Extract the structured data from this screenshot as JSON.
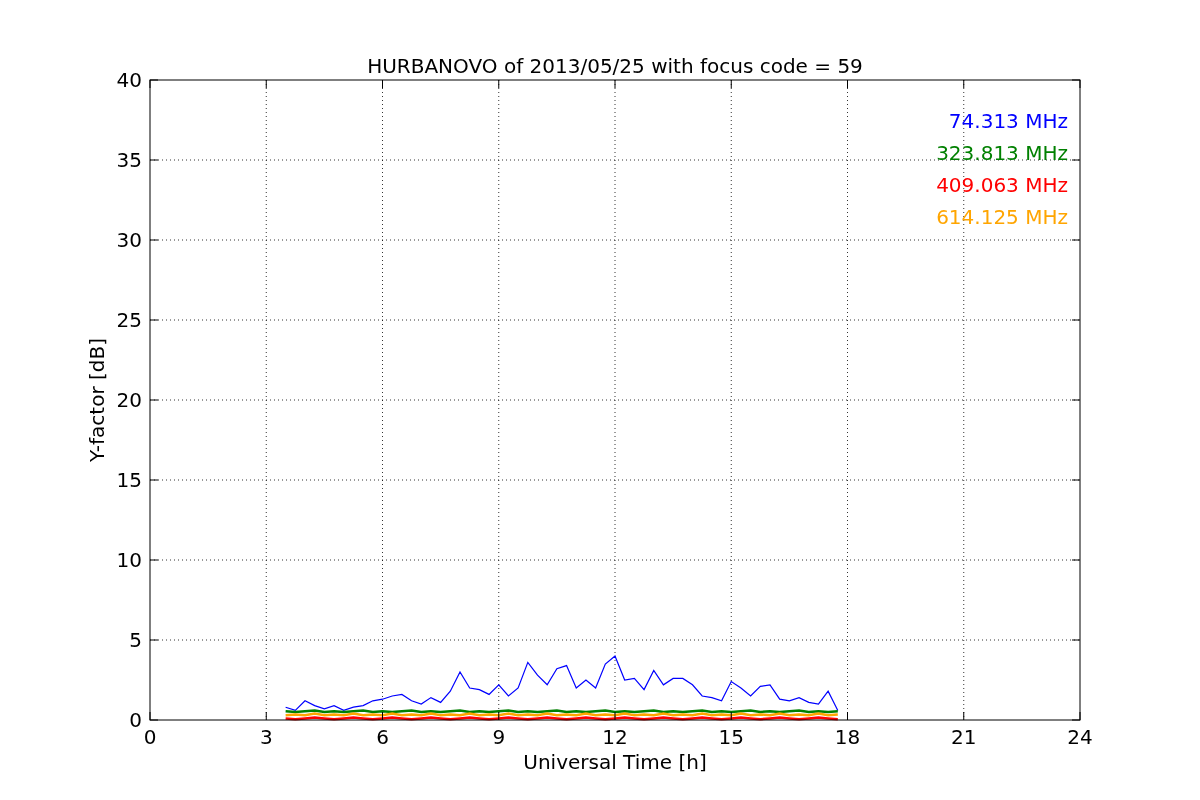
{
  "figure": {
    "chart_data": {
      "type": "line",
      "title": "HURBANOVO of 2013/05/25 with focus code = 59",
      "xlabel": "Universal Time [h]",
      "ylabel": "Y-factor [dB]",
      "x": [
        3.5,
        3.75,
        4,
        4.25,
        4.5,
        4.75,
        5,
        5.25,
        5.5,
        5.75,
        6,
        6.25,
        6.5,
        6.75,
        7,
        7.25,
        7.5,
        7.75,
        8,
        8.25,
        8.5,
        8.75,
        9,
        9.25,
        9.5,
        9.75,
        10,
        10.25,
        10.5,
        10.75,
        11,
        11.25,
        11.5,
        11.75,
        12,
        12.25,
        12.5,
        12.75,
        13,
        13.25,
        13.5,
        13.75,
        14,
        14.25,
        14.5,
        14.75,
        15,
        15.25,
        15.5,
        15.75,
        16,
        16.25,
        16.5,
        16.75,
        17,
        17.25,
        17.5,
        17.75
      ],
      "series": [
        {
          "name": "74.313 MHz",
          "color": "#0000ff",
          "values": [
            0.8,
            0.6,
            1.2,
            0.9,
            0.7,
            0.9,
            0.6,
            0.8,
            0.9,
            1.2,
            1.3,
            1.5,
            1.6,
            1.2,
            1.0,
            1.4,
            1.1,
            1.8,
            3.0,
            2.0,
            1.9,
            1.6,
            2.2,
            1.5,
            2.0,
            3.6,
            2.8,
            2.2,
            3.2,
            3.4,
            2.0,
            2.5,
            2.0,
            3.5,
            4.0,
            2.5,
            2.6,
            1.9,
            3.1,
            2.2,
            2.6,
            2.6,
            2.2,
            1.5,
            1.4,
            1.2,
            2.4,
            2.0,
            1.5,
            2.1,
            2.2,
            1.3,
            1.2,
            1.4,
            1.1,
            1.0,
            1.8,
            0.6
          ]
        },
        {
          "name": "323.813 MHz",
          "color": "#008000",
          "values": [
            0.55,
            0.5,
            0.55,
            0.6,
            0.5,
            0.55,
            0.5,
            0.55,
            0.6,
            0.5,
            0.55,
            0.5,
            0.55,
            0.6,
            0.5,
            0.55,
            0.5,
            0.55,
            0.6,
            0.5,
            0.55,
            0.5,
            0.55,
            0.6,
            0.5,
            0.55,
            0.5,
            0.55,
            0.6,
            0.5,
            0.55,
            0.5,
            0.55,
            0.6,
            0.5,
            0.55,
            0.5,
            0.55,
            0.6,
            0.5,
            0.55,
            0.5,
            0.55,
            0.6,
            0.5,
            0.55,
            0.5,
            0.55,
            0.6,
            0.5,
            0.55,
            0.5,
            0.55,
            0.6,
            0.5,
            0.55,
            0.5,
            0.55
          ]
        },
        {
          "name": "409.063 MHz",
          "color": "#ff0000",
          "values": [
            0.1,
            0.05,
            0.1,
            0.15,
            0.1,
            0.05,
            0.1,
            0.15,
            0.1,
            0.05,
            0.1,
            0.15,
            0.1,
            0.05,
            0.1,
            0.15,
            0.1,
            0.05,
            0.1,
            0.15,
            0.1,
            0.05,
            0.1,
            0.15,
            0.1,
            0.05,
            0.1,
            0.15,
            0.1,
            0.05,
            0.1,
            0.15,
            0.1,
            0.05,
            0.1,
            0.15,
            0.1,
            0.05,
            0.1,
            0.15,
            0.1,
            0.05,
            0.1,
            0.15,
            0.1,
            0.05,
            0.1,
            0.15,
            0.1,
            0.05,
            0.1,
            0.15,
            0.1,
            0.05,
            0.1,
            0.15,
            0.1,
            0.05
          ]
        },
        {
          "name": "614.125 MHz",
          "color": "#ffa500",
          "values": [
            0.3,
            0.35,
            0.3,
            0.4,
            0.3,
            0.35,
            0.3,
            0.4,
            0.3,
            0.35,
            0.3,
            0.4,
            0.3,
            0.35,
            0.3,
            0.4,
            0.3,
            0.35,
            0.3,
            0.4,
            0.3,
            0.35,
            0.3,
            0.4,
            0.3,
            0.35,
            0.3,
            0.4,
            0.3,
            0.35,
            0.3,
            0.4,
            0.3,
            0.35,
            0.3,
            0.4,
            0.3,
            0.35,
            0.3,
            0.4,
            0.3,
            0.35,
            0.3,
            0.4,
            0.3,
            0.35,
            0.3,
            0.4,
            0.3,
            0.35,
            0.3,
            0.4,
            0.3,
            0.35,
            0.3,
            0.4,
            0.3,
            0.35
          ]
        }
      ],
      "grid": true,
      "xlim": [
        0,
        24
      ],
      "ylim": [
        0,
        40
      ],
      "xticks": [
        0,
        3,
        6,
        9,
        12,
        15,
        18,
        21,
        24
      ],
      "yticks": [
        0,
        5,
        10,
        15,
        20,
        25,
        30,
        35,
        40
      ]
    }
  }
}
